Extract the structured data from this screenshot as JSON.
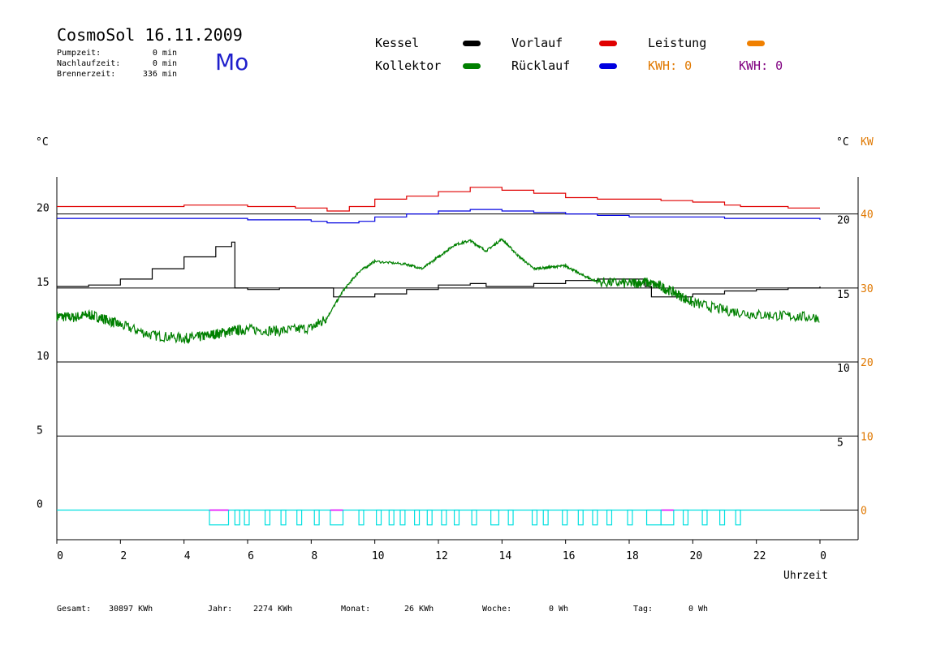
{
  "header": {
    "title": "CosmoSol 16.11.2009",
    "day": "Mo",
    "stats": [
      {
        "label": "Pumpzeit:",
        "value": "0 min"
      },
      {
        "label": "Nachlaufzeit:",
        "value": "0 min"
      },
      {
        "label": "Brennerzeit:",
        "value": "336 min"
      }
    ]
  },
  "legend": {
    "kessel": {
      "label": "Kessel",
      "color": "#000000"
    },
    "kollektor": {
      "label": "Kollektor",
      "color": "#008000"
    },
    "vorlauf": {
      "label": "Vorlauf",
      "color": "#e00000"
    },
    "ruecklauf": {
      "label": "Rücklauf",
      "color": "#0000e0"
    },
    "leistung": {
      "label": "Leistung",
      "color": "#f08000"
    },
    "kwh1": {
      "label": "KWH: 0",
      "color": "#e07800"
    },
    "kwh2": {
      "label": "KWH: 0",
      "color": "#800080"
    }
  },
  "axes": {
    "left_unit": "°C",
    "right_unit": "°C",
    "right_unit2": "KW",
    "xlabel": "Uhrzeit"
  },
  "footer": [
    {
      "label": "Gesamt:",
      "value": "30897 KWh"
    },
    {
      "label": "Jahr:",
      "value": "2274 KWh"
    },
    {
      "label": "Monat:",
      "value": "26 KWh"
    },
    {
      "label": "Woche:",
      "value": "0 Wh"
    },
    {
      "label": "Tag:",
      "value": "0 Wh"
    }
  ],
  "chart_data": {
    "type": "line",
    "x_ticks": [
      "0",
      "2",
      "4",
      "6",
      "8",
      "10",
      "12",
      "14",
      "16",
      "18",
      "20",
      "22",
      "0"
    ],
    "y_left_ticks": [
      "0",
      "5",
      "10",
      "15",
      "20"
    ],
    "y_right_ticks": [
      "5",
      "10",
      "15",
      "20"
    ],
    "y_right2_ticks": [
      "0",
      "10",
      "20",
      "30",
      "40"
    ],
    "xlim": [
      0,
      24
    ],
    "ylim": [
      -2,
      22.5
    ],
    "grid_y": [
      0,
      5,
      10,
      15,
      20
    ],
    "series": [
      {
        "name": "Vorlauf",
        "color": "#e00000",
        "x": [
          0,
          2,
          4,
          6,
          7.5,
          8.5,
          9.2,
          10,
          11,
          12,
          13,
          14,
          15,
          16,
          17,
          18,
          19,
          20,
          21,
          21.5,
          22,
          23,
          24
        ],
        "y": [
          20.5,
          20.5,
          20.6,
          20.5,
          20.4,
          20.2,
          20.5,
          21,
          21.2,
          21.5,
          21.8,
          21.6,
          21.4,
          21.1,
          21,
          21,
          20.9,
          20.8,
          20.6,
          20.5,
          20.5,
          20.4,
          20.4
        ]
      },
      {
        "name": "Rücklauf",
        "color": "#0000e0",
        "x": [
          0,
          2,
          4,
          6,
          8,
          8.5,
          9.5,
          10,
          11,
          12,
          13,
          14,
          15,
          16,
          17,
          18,
          19,
          20,
          21,
          22,
          23,
          24
        ],
        "y": [
          19.7,
          19.7,
          19.7,
          19.6,
          19.5,
          19.4,
          19.5,
          19.8,
          20,
          20.2,
          20.3,
          20.2,
          20.1,
          20,
          19.9,
          19.8,
          19.8,
          19.8,
          19.7,
          19.7,
          19.7,
          19.6
        ]
      },
      {
        "name": "Kessel",
        "color": "#000000",
        "x": [
          0,
          1,
          2,
          3,
          4,
          5,
          5.5,
          5.6,
          6,
          7,
          8,
          8.5,
          8.7,
          9,
          10,
          11,
          12,
          13,
          13.5,
          14,
          15,
          16,
          17,
          18,
          18.5,
          18.7,
          19,
          20,
          21,
          22,
          23,
          24
        ],
        "y": [
          15.1,
          15.2,
          15.6,
          16.3,
          17.1,
          17.8,
          18.1,
          15,
          14.9,
          15,
          15,
          15,
          14.4,
          14.4,
          14.6,
          14.9,
          15.2,
          15.3,
          15.1,
          15.1,
          15.3,
          15.5,
          15.6,
          15.6,
          15.1,
          14.4,
          14.4,
          14.6,
          14.8,
          14.9,
          15,
          15.1
        ]
      },
      {
        "name": "Kollektor",
        "color": "#008000",
        "x": [
          0,
          0.5,
          1,
          1.5,
          2,
          3,
          4,
          4.5,
          5,
          5.5,
          6,
          7,
          8,
          8.5,
          9,
          9.5,
          10,
          11,
          11.5,
          12,
          12.5,
          13,
          13.5,
          14,
          14.5,
          15,
          15.5,
          16,
          16.5,
          17,
          18,
          18.5,
          19,
          19.5,
          20,
          21,
          22,
          23,
          24
        ],
        "y": [
          13.1,
          13,
          13.2,
          12.9,
          12.5,
          11.8,
          11.6,
          11.7,
          11.9,
          12.1,
          12.2,
          12.1,
          12.3,
          13,
          14.8,
          16.1,
          16.8,
          16.6,
          16.3,
          17.1,
          17.9,
          18.2,
          17.5,
          18.3,
          17.2,
          16.3,
          16.4,
          16.5,
          15.9,
          15.4,
          15.3,
          15.4,
          15.1,
          14.6,
          14,
          13.5,
          13.2,
          13.1,
          13
        ]
      }
    ],
    "pulses": [
      {
        "start": 4.8,
        "end": 5.4,
        "color": "#ff00ff"
      },
      {
        "start": 8.6,
        "end": 9.0,
        "color": "#ff00ff"
      },
      {
        "start": 19.0,
        "end": 19.4,
        "color": "#ff00ff"
      },
      {
        "start": 5.6,
        "end": 5.75
      },
      {
        "start": 5.9,
        "end": 6.05
      },
      {
        "start": 6.55,
        "end": 6.7
      },
      {
        "start": 7.05,
        "end": 7.2
      },
      {
        "start": 7.55,
        "end": 7.7
      },
      {
        "start": 8.1,
        "end": 8.25
      },
      {
        "start": 9.5,
        "end": 9.65
      },
      {
        "start": 10.05,
        "end": 10.2
      },
      {
        "start": 10.45,
        "end": 10.6
      },
      {
        "start": 10.8,
        "end": 10.95
      },
      {
        "start": 11.25,
        "end": 11.4
      },
      {
        "start": 11.65,
        "end": 11.8
      },
      {
        "start": 12.1,
        "end": 12.25
      },
      {
        "start": 12.5,
        "end": 12.65
      },
      {
        "start": 13.05,
        "end": 13.2
      },
      {
        "start": 13.65,
        "end": 13.9
      },
      {
        "start": 14.2,
        "end": 14.35
      },
      {
        "start": 14.95,
        "end": 15.1
      },
      {
        "start": 15.3,
        "end": 15.45
      },
      {
        "start": 15.9,
        "end": 16.05
      },
      {
        "start": 16.4,
        "end": 16.55
      },
      {
        "start": 16.85,
        "end": 17.0
      },
      {
        "start": 17.3,
        "end": 17.45
      },
      {
        "start": 17.95,
        "end": 18.1
      },
      {
        "start": 18.55,
        "end": 19.0
      },
      {
        "start": 19.7,
        "end": 19.85
      },
      {
        "start": 20.3,
        "end": 20.45
      },
      {
        "start": 20.85,
        "end": 21.0
      },
      {
        "start": 21.35,
        "end": 21.5
      }
    ],
    "pulse_color": "#00e0e0"
  }
}
